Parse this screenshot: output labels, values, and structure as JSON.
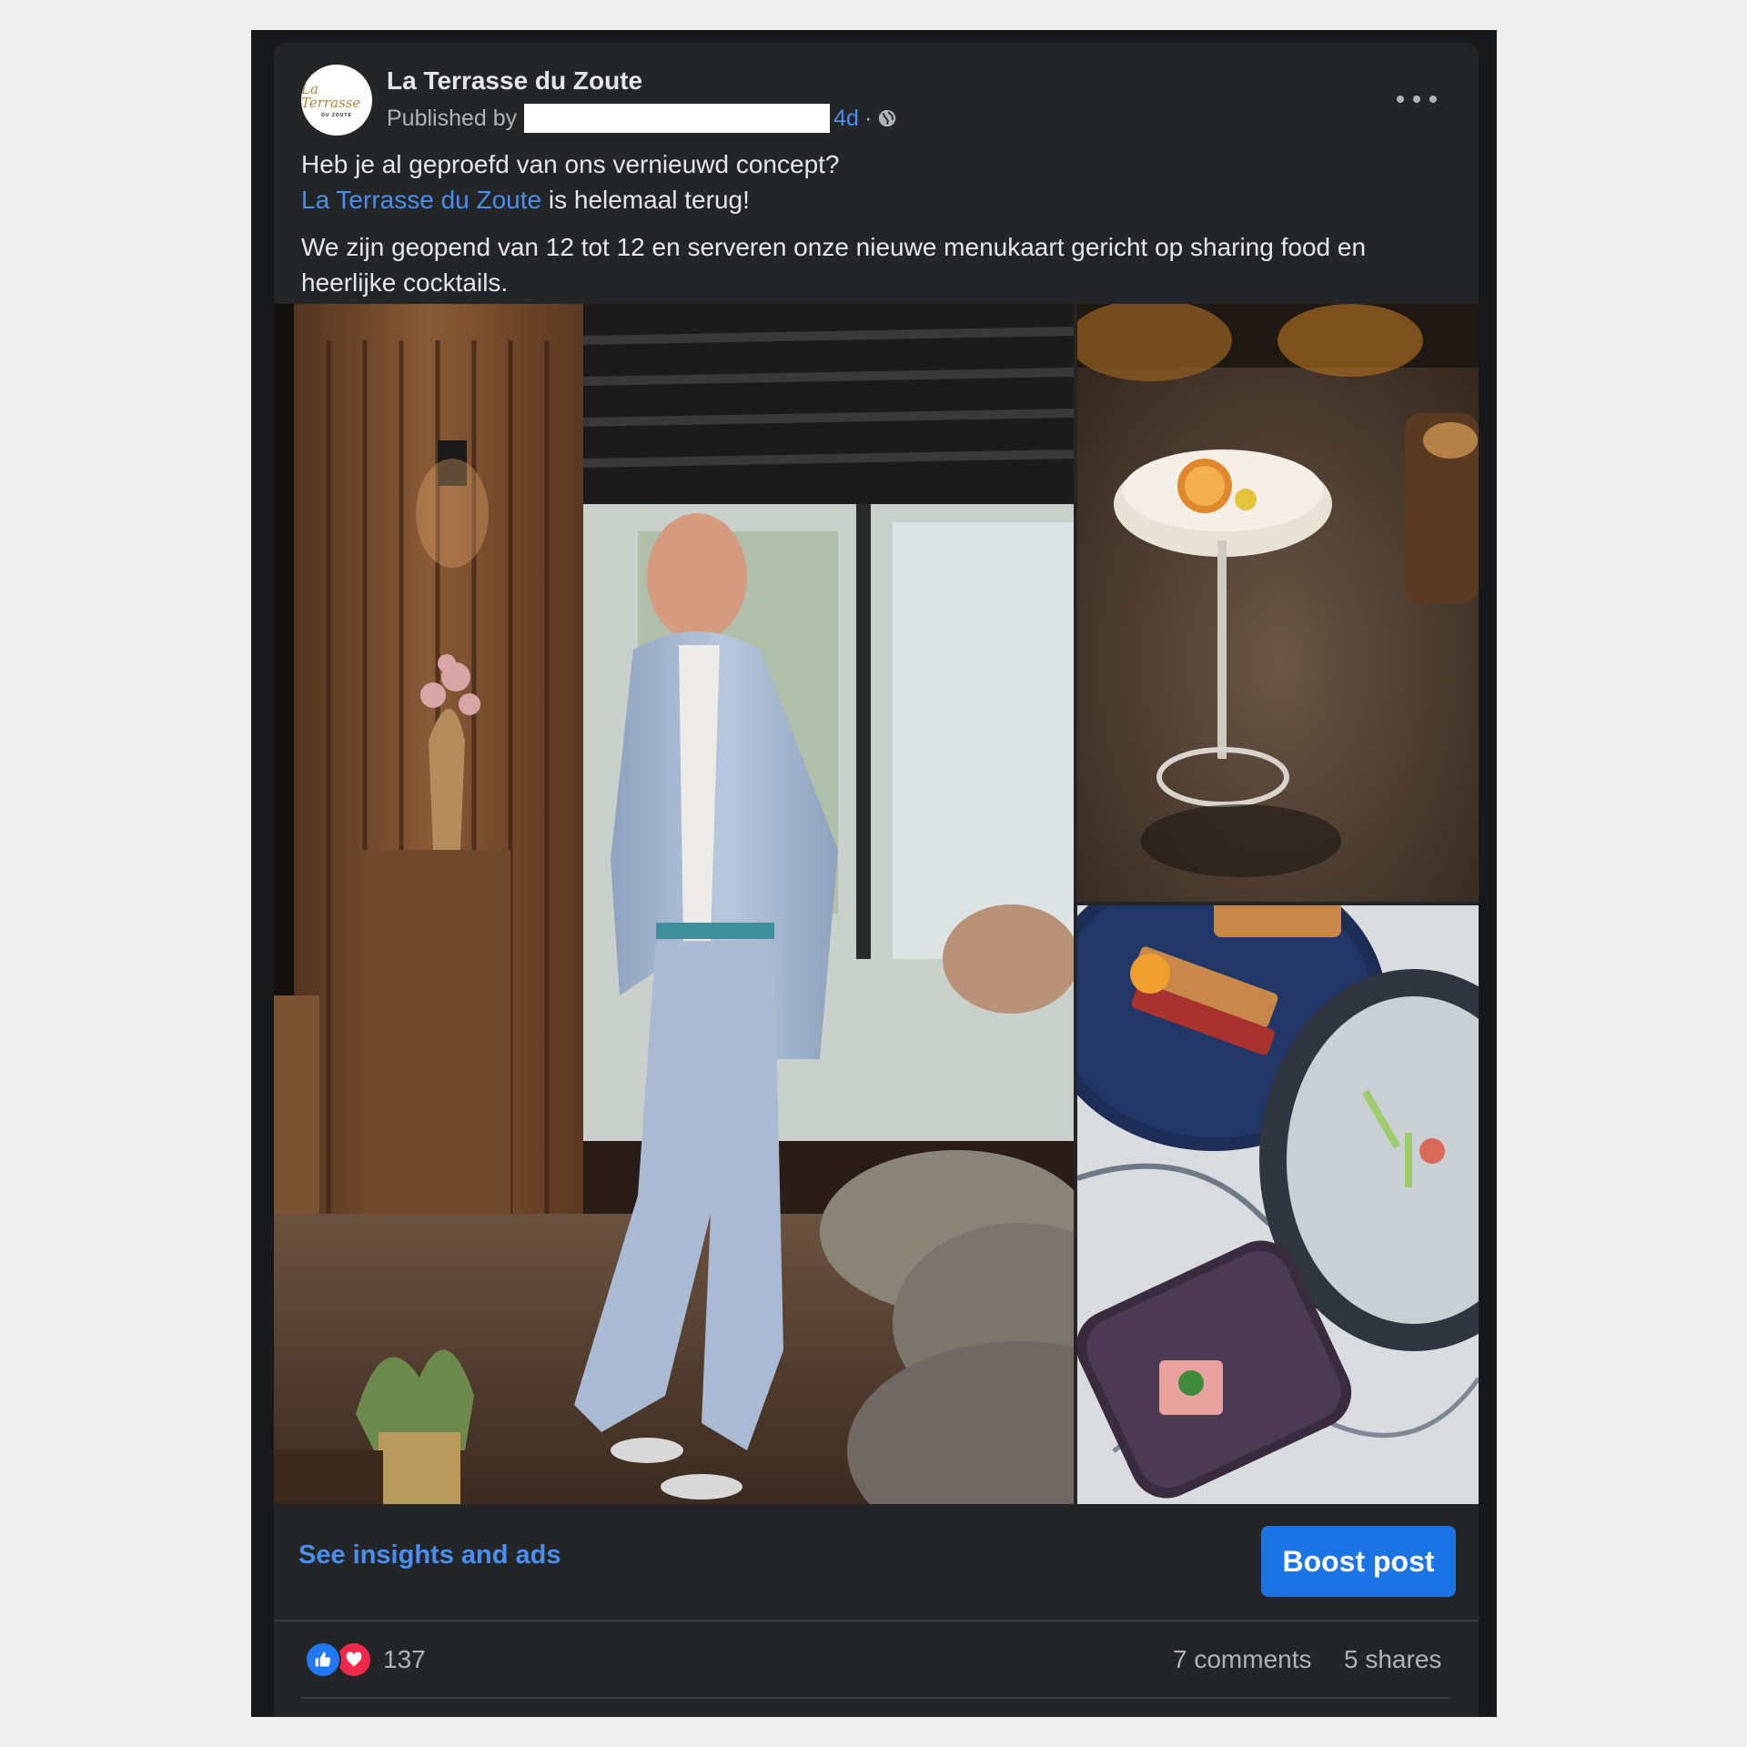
{
  "post": {
    "page_name": "La Terrasse du Zoute",
    "published_by_label": "Published by",
    "age": "4d",
    "separator": "·",
    "visibility_icon": "globe-icon",
    "more_icon": "more-options-icon",
    "avatar_logo_text": "La Terrasse",
    "avatar_logo_subtext": "DU ZOUTE",
    "text": {
      "line1": "Heb je al geproefd van ons vernieuwd concept?",
      "mention": "La Terrasse du Zoute",
      "line2_rest": " is helemaal terug!",
      "paragraph2": "We zijn geopend van 12 tot 12 en serveren onze nieuwe menukaart gericht op sharing food en heerlijke cocktails."
    }
  },
  "actions": {
    "insights_link": "See insights and ads",
    "boost_button": "Boost post"
  },
  "stats": {
    "reaction_icons": [
      "like-icon",
      "love-icon"
    ],
    "reaction_count": "137",
    "comments": "7 comments",
    "shares": "5 shares"
  },
  "colors": {
    "card_background": "#242526",
    "link_blue": "#4a8ff0",
    "boost_blue": "#1b74e4",
    "primary_text": "#e4e6eb",
    "secondary_text": "#b0b3b8"
  }
}
